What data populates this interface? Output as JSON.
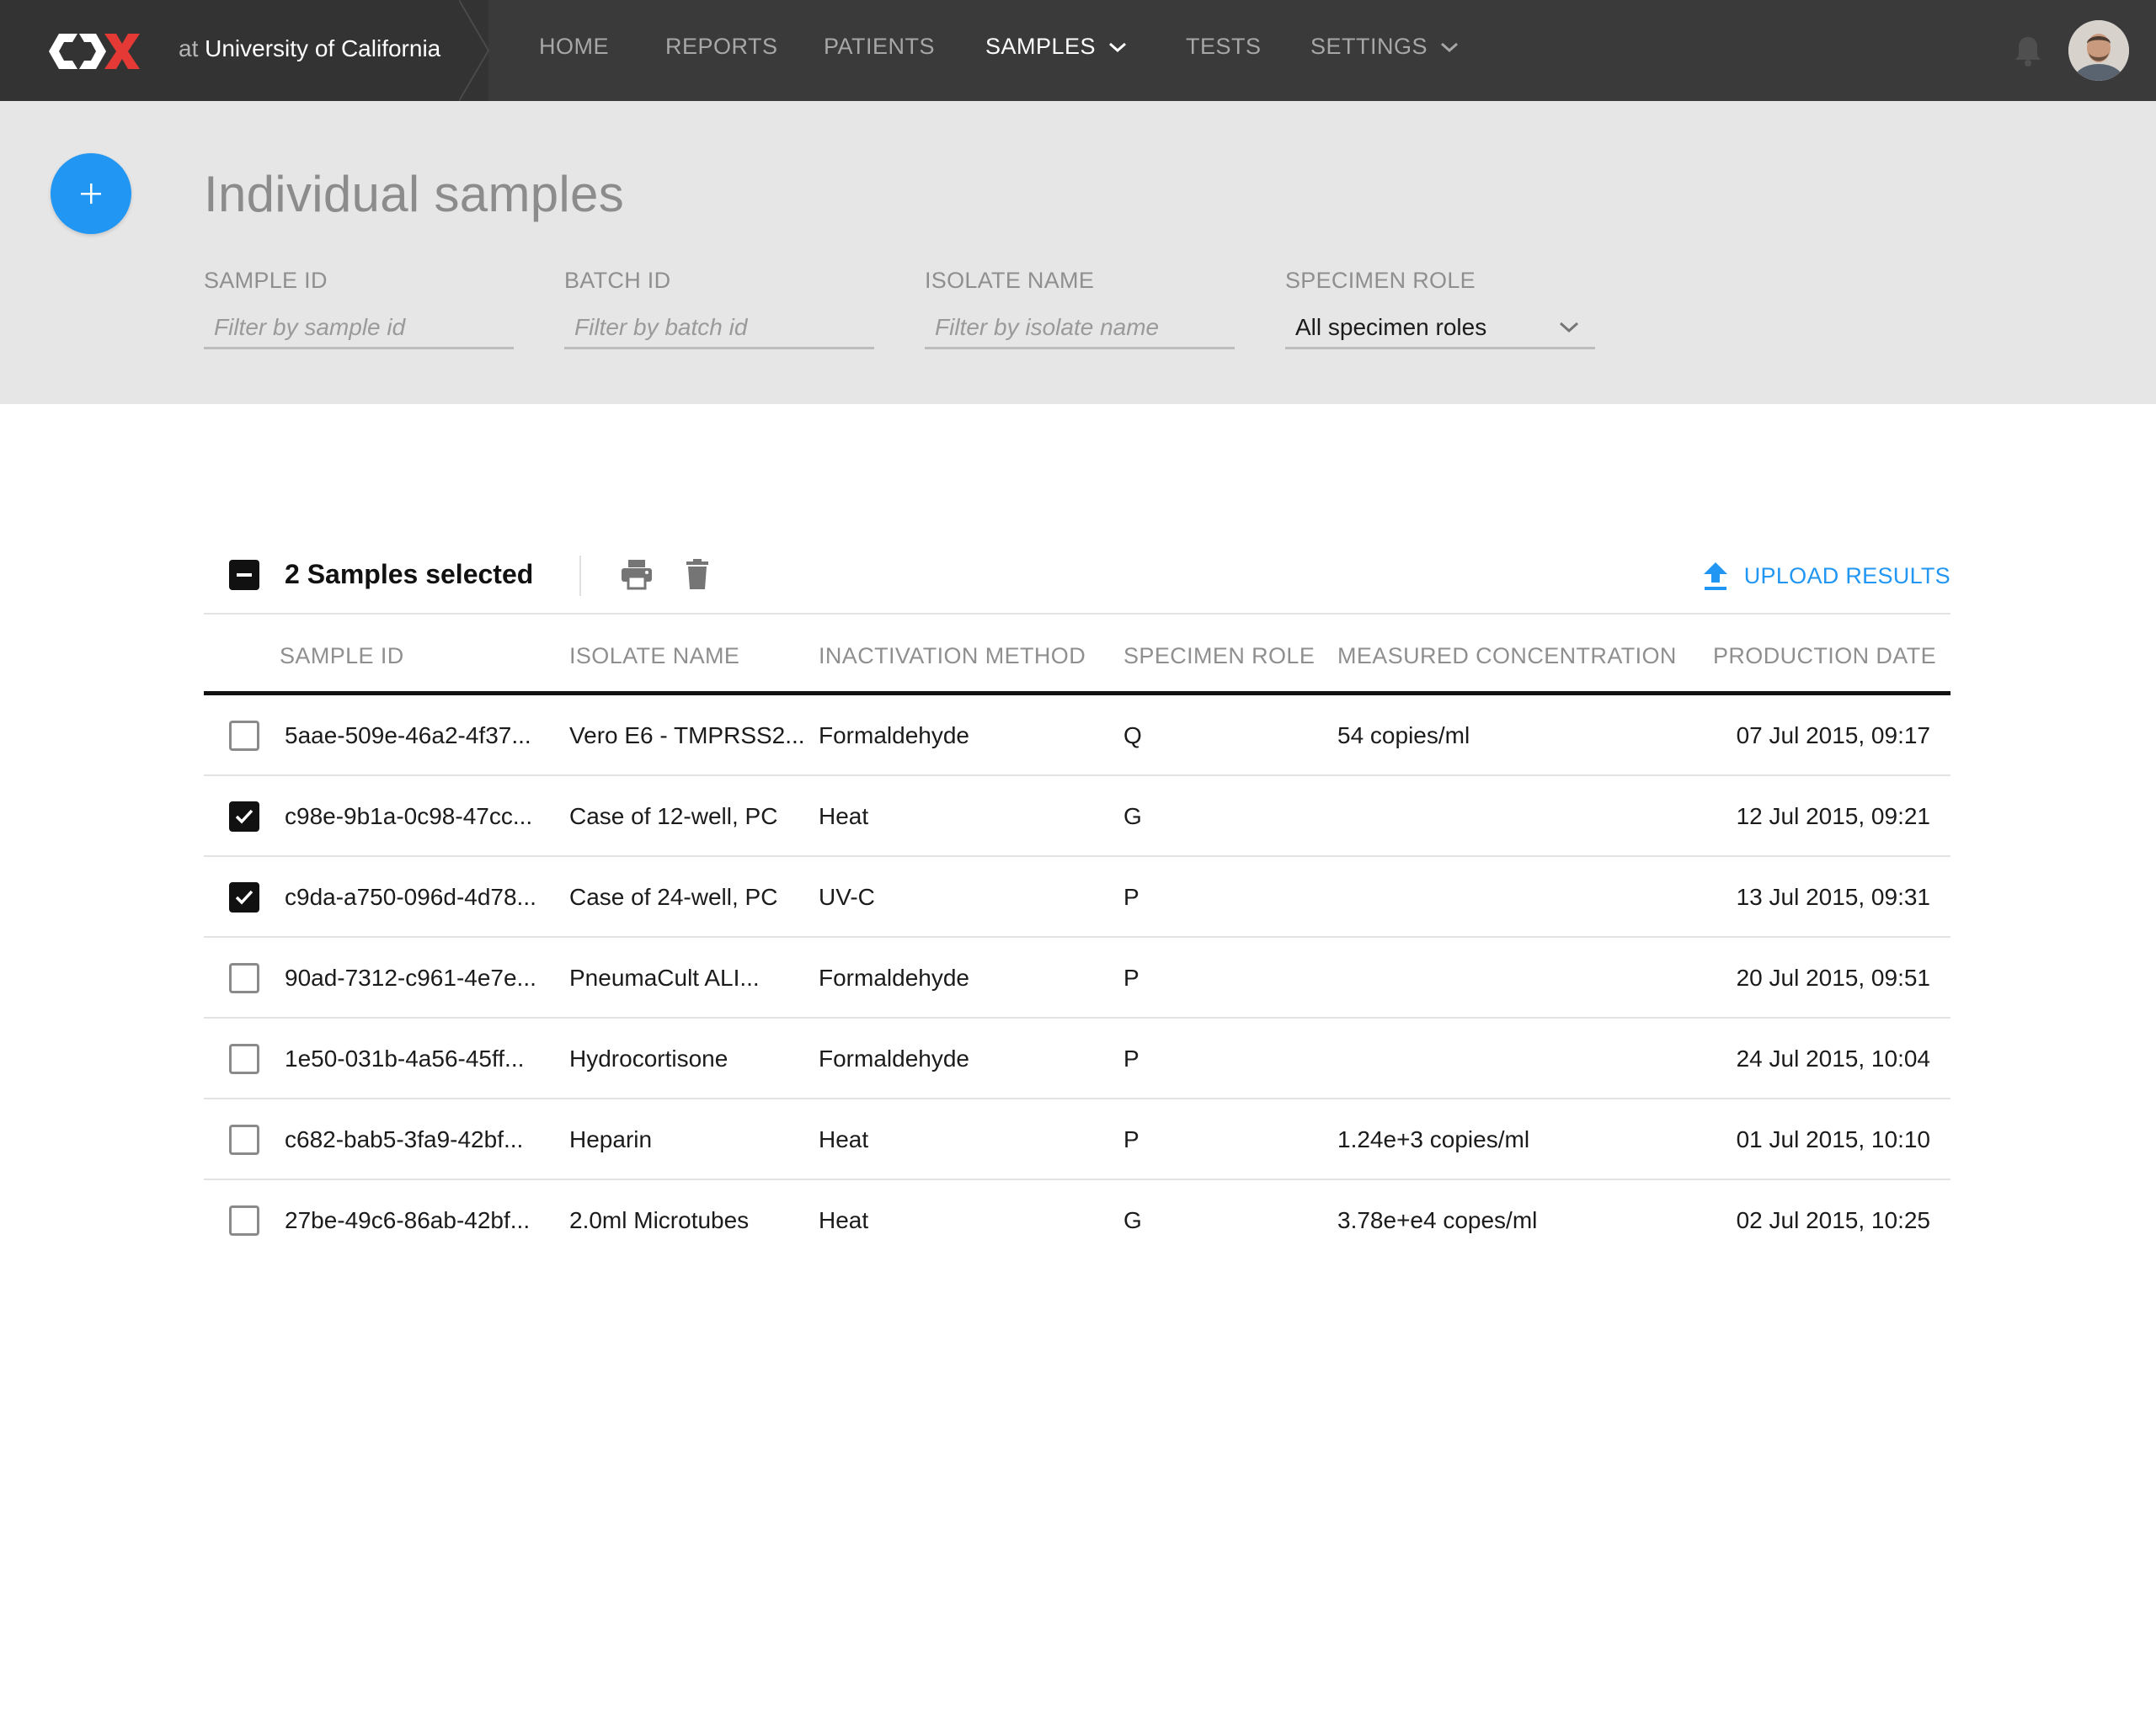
{
  "header": {
    "org_prefix": "at",
    "org_name": "University of California",
    "nav": [
      {
        "label": "HOME"
      },
      {
        "label": "REPORTS"
      },
      {
        "label": "PATIENTS"
      },
      {
        "label": "SAMPLES",
        "active": true,
        "dropdown": true
      },
      {
        "label": "TESTS"
      },
      {
        "label": "SETTINGS",
        "dropdown": true
      }
    ],
    "icons": [
      "cdx-logo",
      "bell-icon",
      "user-avatar"
    ]
  },
  "page": {
    "title": "Individual samples",
    "add_button_icon": "plus-icon",
    "accent_color": "#2196f3"
  },
  "filters": {
    "sample_id": {
      "label": "SAMPLE ID",
      "placeholder": "Filter by sample id",
      "value": ""
    },
    "batch_id": {
      "label": "BATCH ID",
      "placeholder": "Filter by batch id",
      "value": ""
    },
    "isolate_name": {
      "label": "ISOLATE NAME",
      "placeholder": "Filter by isolate name",
      "value": ""
    },
    "specimen_role": {
      "label": "SPECIMEN ROLE",
      "value": "All specimen roles"
    }
  },
  "toolbar": {
    "selection_text": "2 Samples selected",
    "upload_label": "UPLOAD RESULTS",
    "icons": [
      "print-icon",
      "trash-icon",
      "upload-icon"
    ]
  },
  "table": {
    "columns": [
      "SAMPLE ID",
      "ISOLATE NAME",
      "INACTIVATION METHOD",
      "SPECIMEN ROLE",
      "MEASURED CONCENTRATION",
      "PRODUCTION DATE"
    ],
    "rows": [
      {
        "checked": false,
        "sample_id": "5aae-509e-46a2-4f37...",
        "isolate": "Vero E6 - TMPRSS2...",
        "method": "Formaldehyde",
        "role": "Q",
        "concentration": "54 copies/ml",
        "date": "07 Jul 2015, 09:17"
      },
      {
        "checked": true,
        "sample_id": "c98e-9b1a-0c98-47cc...",
        "isolate": "Case of 12-well, PC",
        "method": "Heat",
        "role": "G",
        "concentration": "",
        "date": "12 Jul 2015, 09:21"
      },
      {
        "checked": true,
        "sample_id": "c9da-a750-096d-4d78...",
        "isolate": "Case of 24-well, PC",
        "method": "UV-C",
        "role": "P",
        "concentration": "",
        "date": "13 Jul 2015, 09:31"
      },
      {
        "checked": false,
        "sample_id": "90ad-7312-c961-4e7e...",
        "isolate": "PneumaCult ALI...",
        "method": "Formaldehyde",
        "role": "P",
        "concentration": "",
        "date": "20 Jul 2015, 09:51"
      },
      {
        "checked": false,
        "sample_id": "1e50-031b-4a56-45ff...",
        "isolate": "Hydrocortisone",
        "method": "Formaldehyde",
        "role": "P",
        "concentration": "",
        "date": "24 Jul 2015, 10:04"
      },
      {
        "checked": false,
        "sample_id": "c682-bab5-3fa9-42bf...",
        "isolate": "Heparin",
        "method": "Heat",
        "role": "P",
        "concentration": "1.24e+3 copies/ml",
        "date": "01 Jul 2015, 10:10"
      },
      {
        "checked": false,
        "sample_id": "27be-49c6-86ab-42bf...",
        "isolate": "2.0ml Microtubes",
        "method": "Heat",
        "role": "G",
        "concentration": "3.78e+e4 copes/ml",
        "date": "02 Jul 2015, 10:25"
      }
    ]
  }
}
